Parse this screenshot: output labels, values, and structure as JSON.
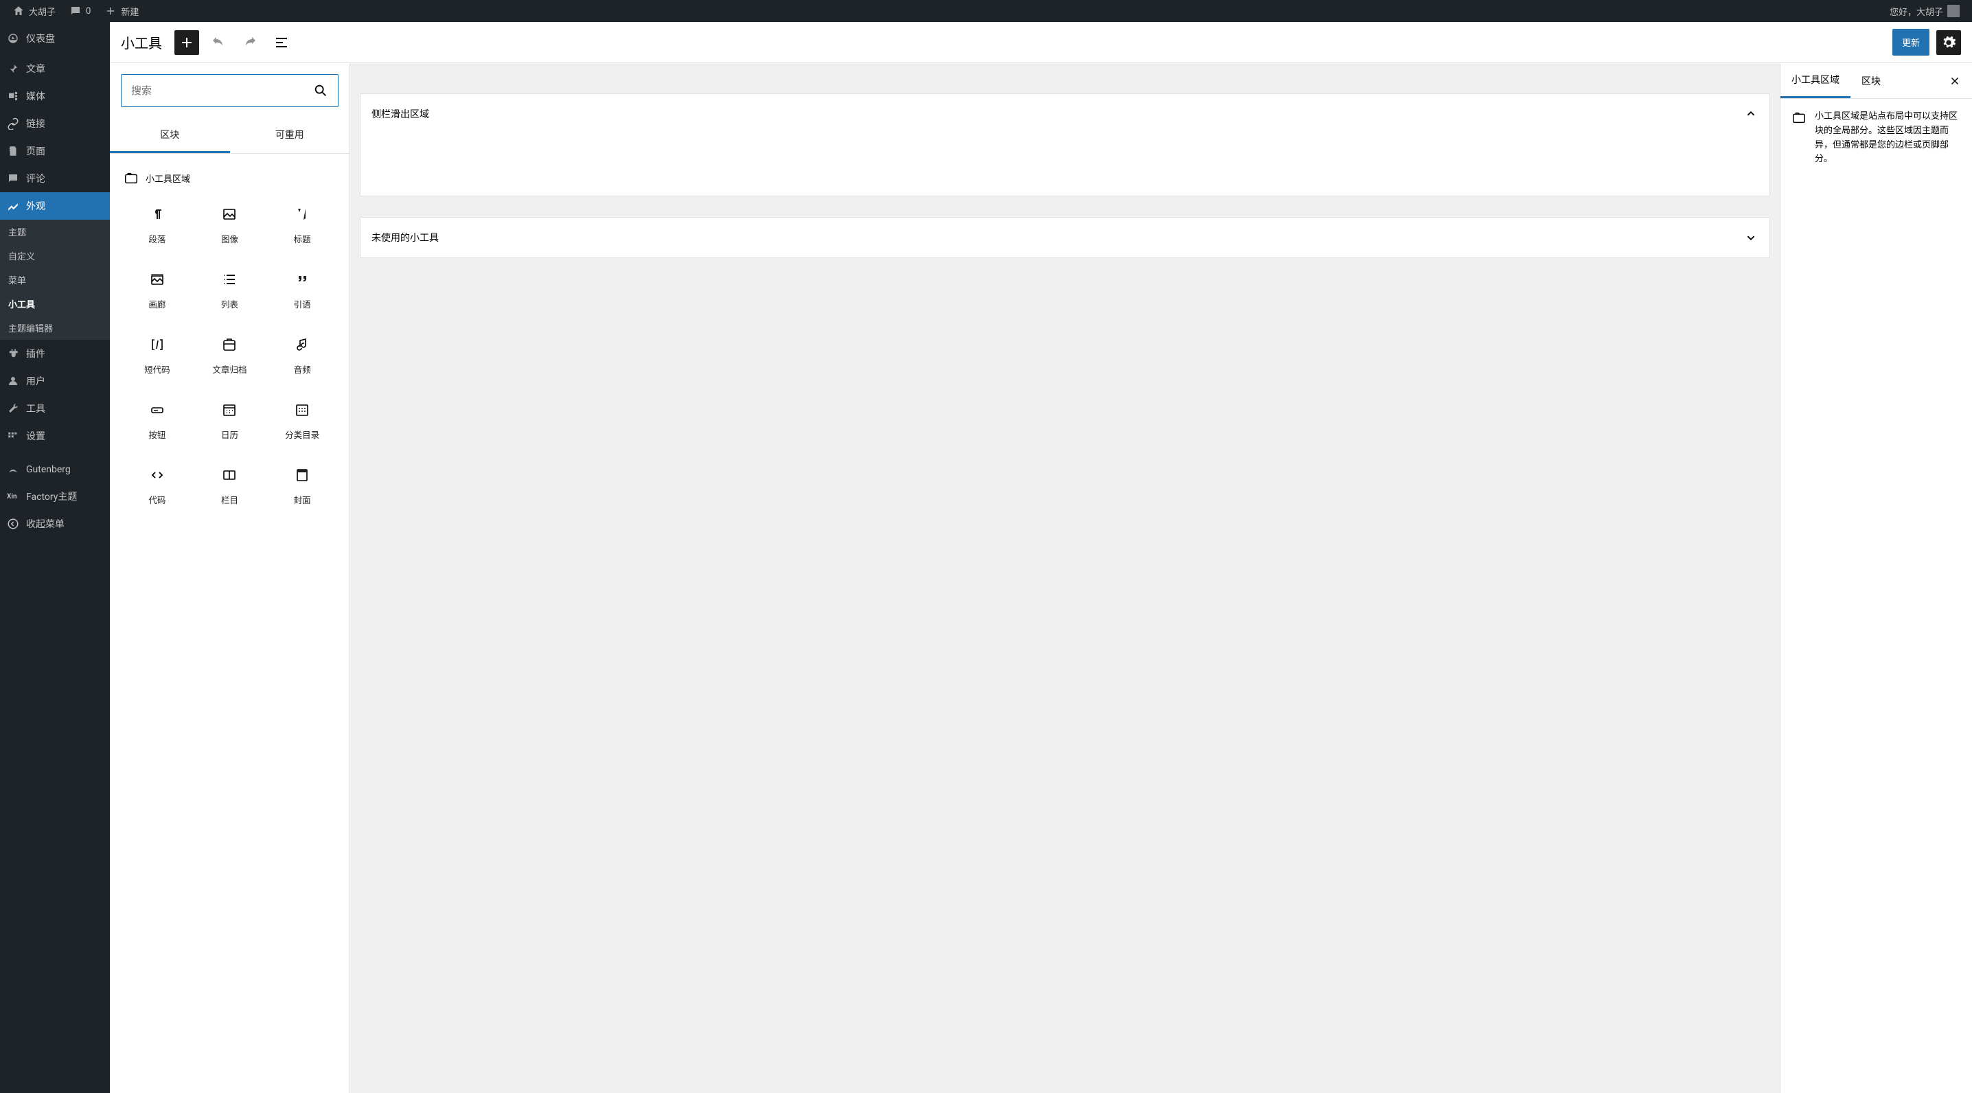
{
  "adminbar": {
    "site_name": "大胡子",
    "comments_count": "0",
    "new_label": "新建",
    "greeting": "您好，大胡子"
  },
  "sidebar": {
    "dashboard": "仪表盘",
    "items": [
      {
        "label": "文章"
      },
      {
        "label": "媒体"
      },
      {
        "label": "链接"
      },
      {
        "label": "页面"
      },
      {
        "label": "评论"
      },
      {
        "label": "外观"
      },
      {
        "label": "插件"
      },
      {
        "label": "用户"
      },
      {
        "label": "工具"
      },
      {
        "label": "设置"
      },
      {
        "label": "Gutenberg"
      },
      {
        "label": "Factory主题"
      },
      {
        "label": "收起菜单"
      }
    ],
    "appearance_sub": [
      {
        "label": "主题"
      },
      {
        "label": "自定义"
      },
      {
        "label": "菜单"
      },
      {
        "label": "小工具"
      },
      {
        "label": "主题编辑器"
      }
    ]
  },
  "editor": {
    "title": "小工具",
    "update_btn": "更新",
    "search_placeholder": "搜索",
    "tabs": {
      "blocks": "区块",
      "reusable": "可重用"
    },
    "category": "小工具区域",
    "blocks": [
      {
        "label": "段落",
        "icon": "paragraph"
      },
      {
        "label": "图像",
        "icon": "image"
      },
      {
        "label": "标题",
        "icon": "heading"
      },
      {
        "label": "画廊",
        "icon": "gallery"
      },
      {
        "label": "列表",
        "icon": "list"
      },
      {
        "label": "引语",
        "icon": "quote"
      },
      {
        "label": "短代码",
        "icon": "shortcode"
      },
      {
        "label": "文章归档",
        "icon": "archive"
      },
      {
        "label": "音频",
        "icon": "audio"
      },
      {
        "label": "按钮",
        "icon": "button"
      },
      {
        "label": "日历",
        "icon": "calendar"
      },
      {
        "label": "分类目录",
        "icon": "categories"
      },
      {
        "label": "代码",
        "icon": "code"
      },
      {
        "label": "栏目",
        "icon": "columns"
      },
      {
        "label": "封面",
        "icon": "cover"
      }
    ]
  },
  "canvas": {
    "area1": "侧栏滑出区域",
    "area2": "未使用的小工具"
  },
  "rightbar": {
    "tab1": "小工具区域",
    "tab2": "区块",
    "description": "小工具区域是站点布局中可以支持区块的全局部分。这些区域因主题而异，但通常都是您的边栏或页脚部分。"
  }
}
